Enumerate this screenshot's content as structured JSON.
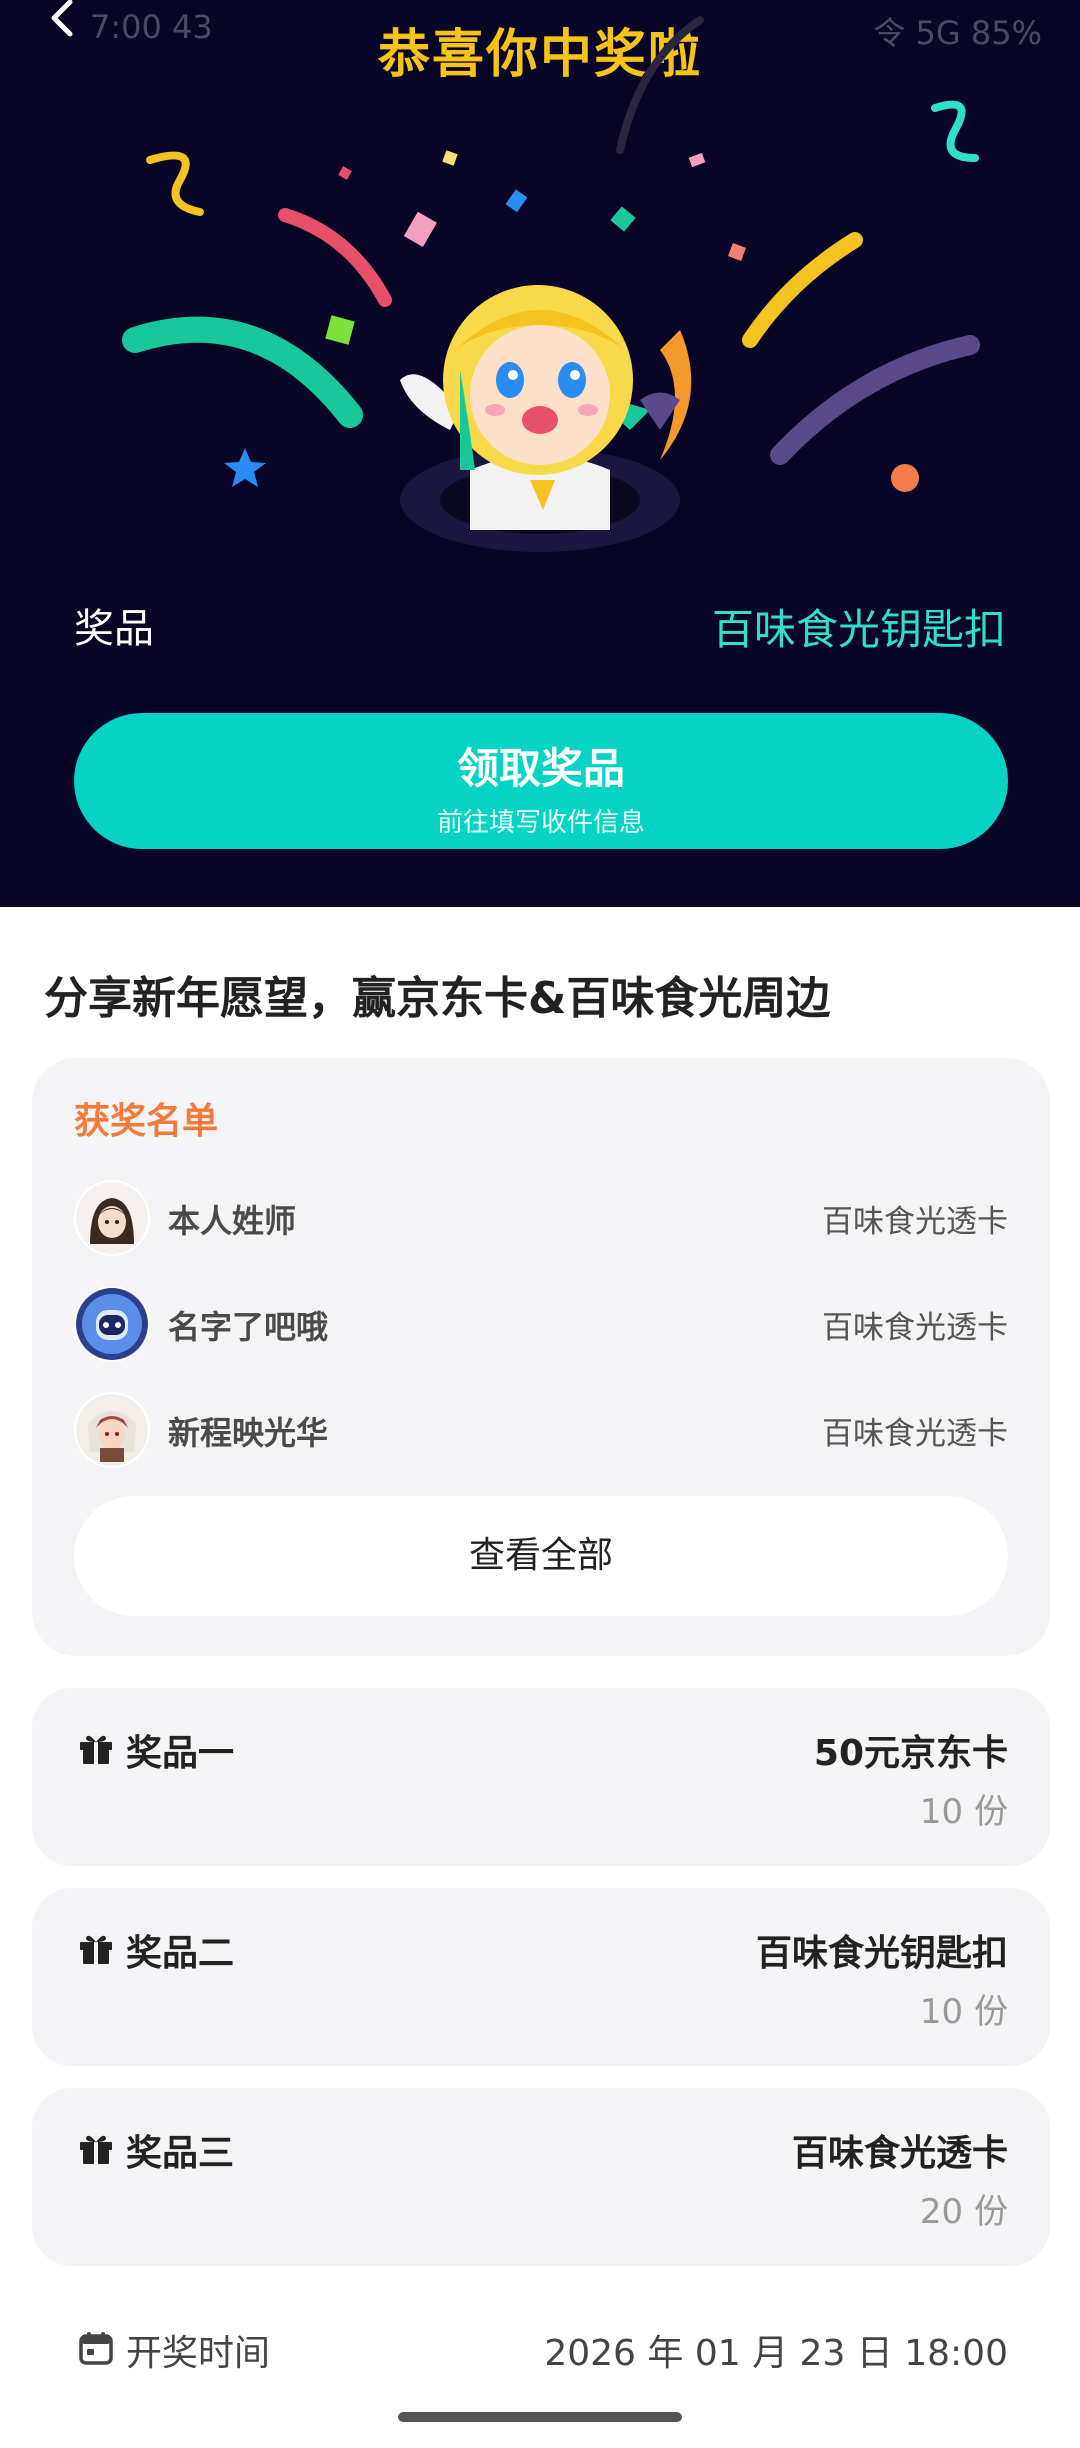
{
  "status_bar": {
    "time": "7:00 43",
    "right": "令 5G 85%"
  },
  "header": {
    "title": "恭喜你中奖啦",
    "back_icon": "chevron-left-icon"
  },
  "prize": {
    "label": "奖品",
    "value": "百味食光钥匙扣"
  },
  "claim_button": {
    "label": "领取奖品",
    "sublabel": "前往填写收件信息"
  },
  "section": {
    "title": "分享新年愿望，赢京东卡&百味食光周边"
  },
  "winners": {
    "title": "获奖名单",
    "items": [
      {
        "name": "本人姓师",
        "prize": "百味食光透卡",
        "avatar": "girl-avatar"
      },
      {
        "name": "名字了吧哦",
        "prize": "百味食光透卡",
        "avatar": "robot-avatar"
      },
      {
        "name": "新程映光华",
        "prize": "百味食光透卡",
        "avatar": "anime-avatar"
      }
    ],
    "view_all": "查看全部"
  },
  "prizes": [
    {
      "label": "奖品一",
      "name": "50元京东卡",
      "quantity": "10 份",
      "icon": "gift-icon"
    },
    {
      "label": "奖品二",
      "name": "百味食光钥匙扣",
      "quantity": "10 份",
      "icon": "gift-icon"
    },
    {
      "label": "奖品三",
      "name": "百味食光透卡",
      "quantity": "20 份",
      "icon": "gift-icon"
    }
  ],
  "draw_time": {
    "label": "开奖时间",
    "value": "2026 年 01 月 23 日 18:00",
    "icon": "calendar-icon"
  },
  "colors": {
    "hero_bg": "#090527",
    "accent": "#05d3c4",
    "title_gold": "#f6c419",
    "winners_title": "#f37a3a"
  }
}
